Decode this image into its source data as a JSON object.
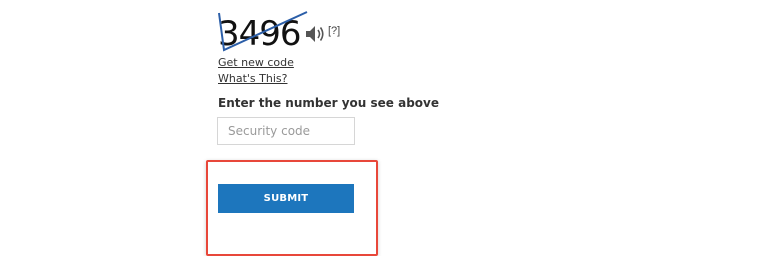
{
  "captcha": {
    "code_image_text": "3496",
    "audio_icon": "speaker-icon",
    "help_label": "[?]"
  },
  "links": {
    "new_code": "Get new code",
    "whats_this": "What's This?"
  },
  "form": {
    "prompt": "Enter the number you see above",
    "input_placeholder": "Security code",
    "input_value": "",
    "submit_label": "SUBMIT"
  },
  "colors": {
    "button_bg": "#1d76bd",
    "highlight_border": "#e8473a",
    "strike_line": "#2b5ea8"
  }
}
